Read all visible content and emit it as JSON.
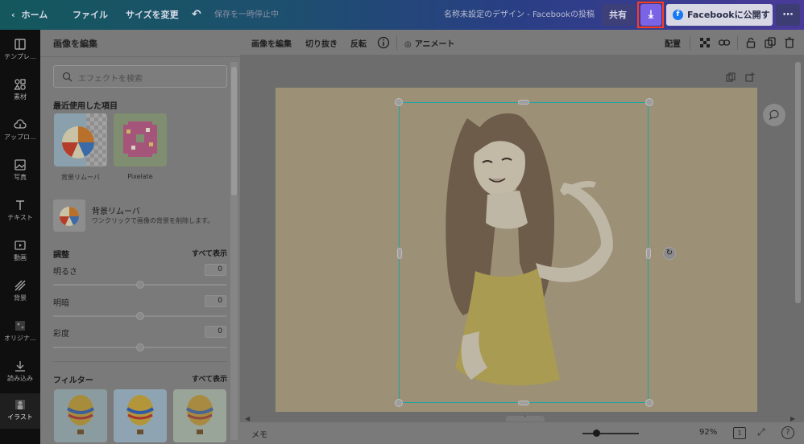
{
  "topbar": {
    "home_label": "ホーム",
    "file_label": "ファイル",
    "resize_label": "サイズを変更",
    "save_status": "保存を一時停止中",
    "design_title": "名称未設定のデザイン - Facebookの投稿",
    "share_label": "共有",
    "publish_label": "Facebookに公開する",
    "accent_download": "#7b63e6",
    "download_highlight": "#ff3b1f"
  },
  "rail": {
    "items": [
      {
        "label": "テンプレ…",
        "icon": "template-icon"
      },
      {
        "label": "素材",
        "icon": "elements-icon"
      },
      {
        "label": "アップロ…",
        "icon": "upload-icon"
      },
      {
        "label": "写真",
        "icon": "photo-icon"
      },
      {
        "label": "テキスト",
        "icon": "text-icon"
      },
      {
        "label": "動画",
        "icon": "video-icon"
      },
      {
        "label": "背景",
        "icon": "background-icon"
      },
      {
        "label": "オリジナ…",
        "icon": "original-icon"
      },
      {
        "label": "読み込み",
        "icon": "import-icon"
      },
      {
        "label": "イラスト",
        "icon": "illust-icon"
      }
    ]
  },
  "panel": {
    "title": "画像を編集",
    "search_placeholder": "エフェクトを検索",
    "recent_title": "最近使用した項目",
    "recent_items": [
      {
        "label": "背景リムーバ"
      },
      {
        "label": "Pixelate"
      }
    ],
    "bg_remover": {
      "title": "背景リムーバ",
      "desc": "ワンクリックで画像の背景を削除します。"
    },
    "adjust": {
      "title": "調整",
      "show_all": "すべて表示",
      "sliders": [
        {
          "label": "明るさ",
          "value": "0"
        },
        {
          "label": "明暗",
          "value": "0"
        },
        {
          "label": "彩度",
          "value": "0"
        }
      ]
    },
    "filter": {
      "title": "フィルター",
      "show_all": "すべて表示"
    }
  },
  "editor_toolbar": {
    "edit_image": "画像を編集",
    "crop": "切り抜き",
    "flip": "反転",
    "animate": "アニメート",
    "position": "配置"
  },
  "bottom": {
    "notes": "メモ",
    "zoom": "92%",
    "page_number": "1",
    "help": "?"
  }
}
